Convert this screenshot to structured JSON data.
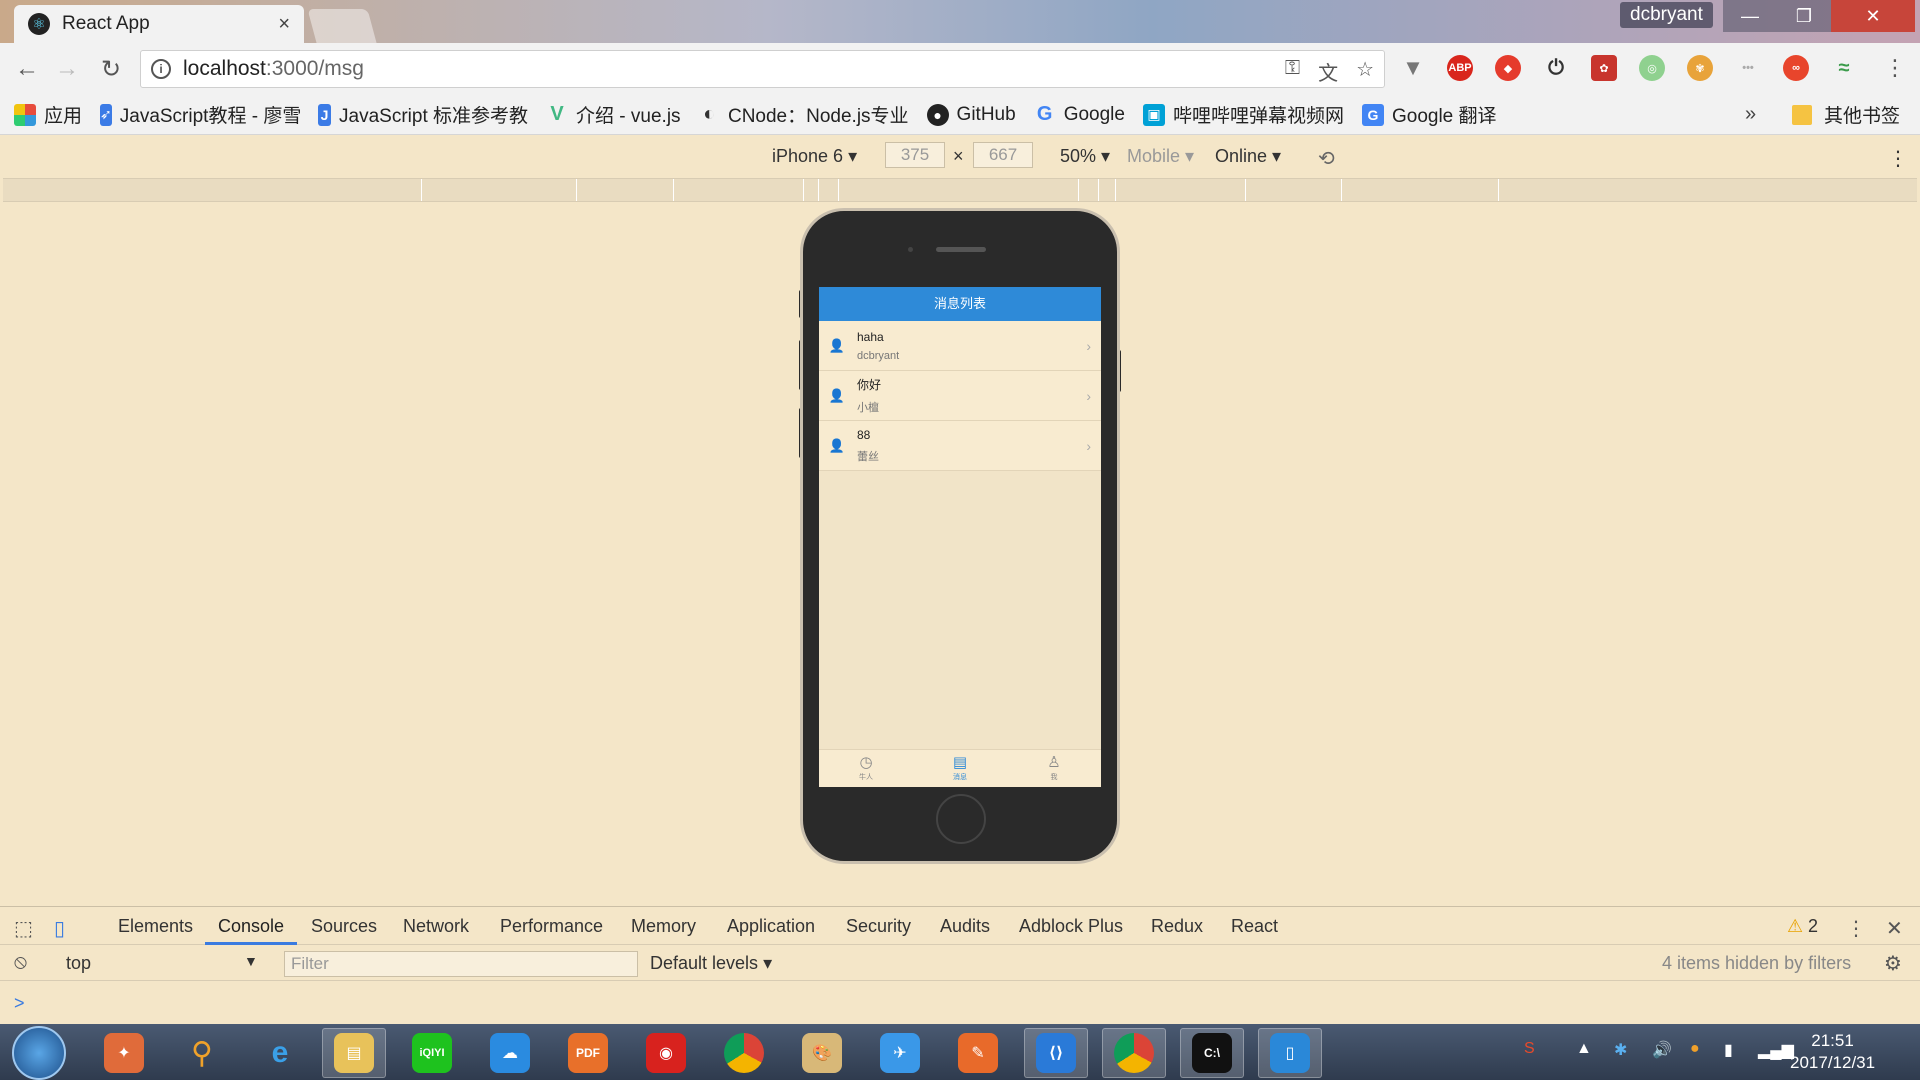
{
  "browser": {
    "tab_title": "React App",
    "tab_close": "×",
    "profile_name": "dcbryant",
    "url_host": "localhost",
    "url_path": ":3000/msg"
  },
  "bookmarks": {
    "apps_label": "应用",
    "items": [
      {
        "label": "JavaScript教程 - 廖雪",
        "icon": "rocket-icon",
        "color": "#3b7be6"
      },
      {
        "label": "JavaScript 标准参考教",
        "icon": "j-icon",
        "color": "#3b7be6"
      },
      {
        "label": "介绍 - vue.js",
        "icon": "vue-icon",
        "color": "#41b883"
      },
      {
        "label": "CNode：Node.js专业",
        "icon": "cnode-icon",
        "color": "#333333"
      },
      {
        "label": "GitHub",
        "icon": "github-icon",
        "color": "#222222"
      },
      {
        "label": "Google",
        "icon": "google-icon",
        "color": "#4285f4"
      },
      {
        "label": "哔哩哔哩弹幕视频网",
        "icon": "bilibili-icon",
        "color": "#00a1d6"
      },
      {
        "label": "Google 翻译",
        "icon": "translate-icon",
        "color": "#4285f4"
      }
    ],
    "more": "»",
    "other_label": "其他书签"
  },
  "device_toolbar": {
    "device": "iPhone 6",
    "width": "375",
    "x": "×",
    "height": "667",
    "zoom": "50%",
    "mode": "Mobile",
    "network": "Online"
  },
  "app": {
    "header_title": "消息列表",
    "messages": [
      {
        "content": "haha",
        "from": "dcbryant"
      },
      {
        "content": "你好",
        "from": "小檀"
      },
      {
        "content": "88",
        "from": "蕾丝"
      }
    ],
    "tabs": [
      {
        "label": "牛人",
        "icon": "clock-icon"
      },
      {
        "label": "消息",
        "icon": "list-icon"
      },
      {
        "label": "我",
        "icon": "user-icon"
      }
    ]
  },
  "devtools": {
    "tabs": [
      "Elements",
      "Console",
      "Sources",
      "Network",
      "Performance",
      "Memory",
      "Application",
      "Security",
      "Audits",
      "Adblock Plus",
      "Redux",
      "React"
    ],
    "active_tab": "Console",
    "warning_count": "2",
    "context": "top",
    "filter_placeholder": "Filter",
    "levels": "Default levels",
    "hidden_info": "4 items hidden by filters",
    "prompt": ">"
  },
  "taskbar": {
    "time": "21:51",
    "date": "2017/12/31"
  }
}
